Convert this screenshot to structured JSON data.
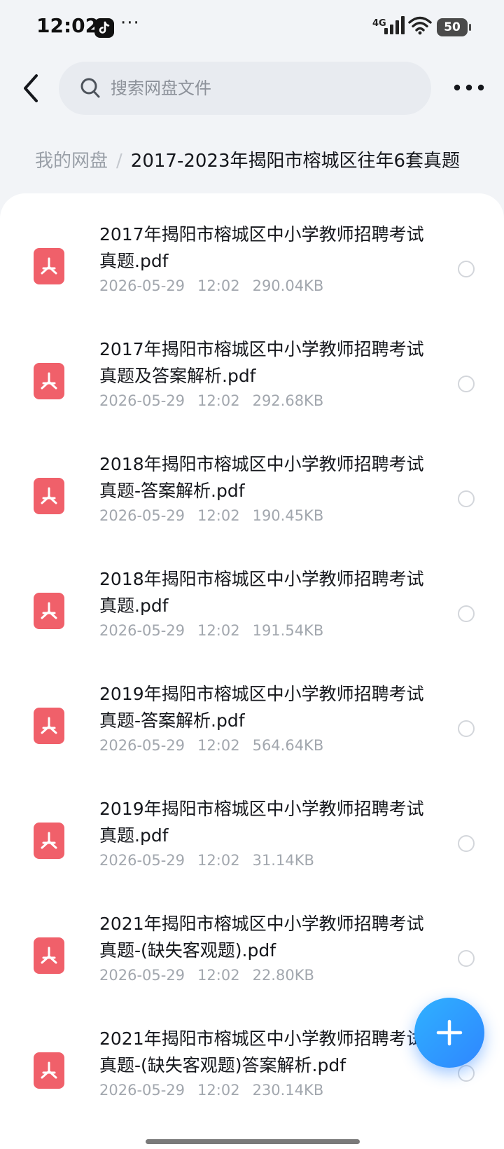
{
  "status_bar": {
    "time": "12:02",
    "more": "···",
    "network": "4G",
    "battery": "50",
    "app_icon": "tiktok-icon"
  },
  "header": {
    "back_icon": "chevron-left-icon",
    "search_placeholder": "搜索网盘文件",
    "more_icon": "more-horizontal-icon"
  },
  "breadcrumb": {
    "root": "我的网盘",
    "separator": "/",
    "current": "2017-2023年揭阳市榕城区往年6套真题"
  },
  "files": [
    {
      "name": "2017年揭阳市榕城区中小学教师招聘考试真题.pdf",
      "date": "2026-05-29",
      "time": "12:02",
      "size": "290.04KB"
    },
    {
      "name": "2017年揭阳市榕城区中小学教师招聘考试真题及答案解析.pdf",
      "date": "2026-05-29",
      "time": "12:02",
      "size": "292.68KB"
    },
    {
      "name": "2018年揭阳市榕城区中小学教师招聘考试真题-答案解析.pdf",
      "date": "2026-05-29",
      "time": "12:02",
      "size": "190.45KB"
    },
    {
      "name": "2018年揭阳市榕城区中小学教师招聘考试真题.pdf",
      "date": "2026-05-29",
      "time": "12:02",
      "size": "191.54KB"
    },
    {
      "name": "2019年揭阳市榕城区中小学教师招聘考试真题-答案解析.pdf",
      "date": "2026-05-29",
      "time": "12:02",
      "size": "564.64KB"
    },
    {
      "name": "2019年揭阳市榕城区中小学教师招聘考试真题.pdf",
      "date": "2026-05-29",
      "time": "12:02",
      "size": "31.14KB"
    },
    {
      "name": "2021年揭阳市榕城区中小学教师招聘考试真题-(缺失客观题).pdf",
      "date": "2026-05-29",
      "time": "12:02",
      "size": "22.80KB"
    },
    {
      "name": "2021年揭阳市榕城区中小学教师招聘考试真题-(缺失客观题)答案解析.pdf",
      "date": "2026-05-29",
      "time": "12:02",
      "size": "230.14KB"
    }
  ],
  "fab": {
    "icon": "plus-icon"
  },
  "colors": {
    "pdf_icon": "#f0606a",
    "accent": "#2f86ff",
    "background": "#f2f4f7"
  }
}
